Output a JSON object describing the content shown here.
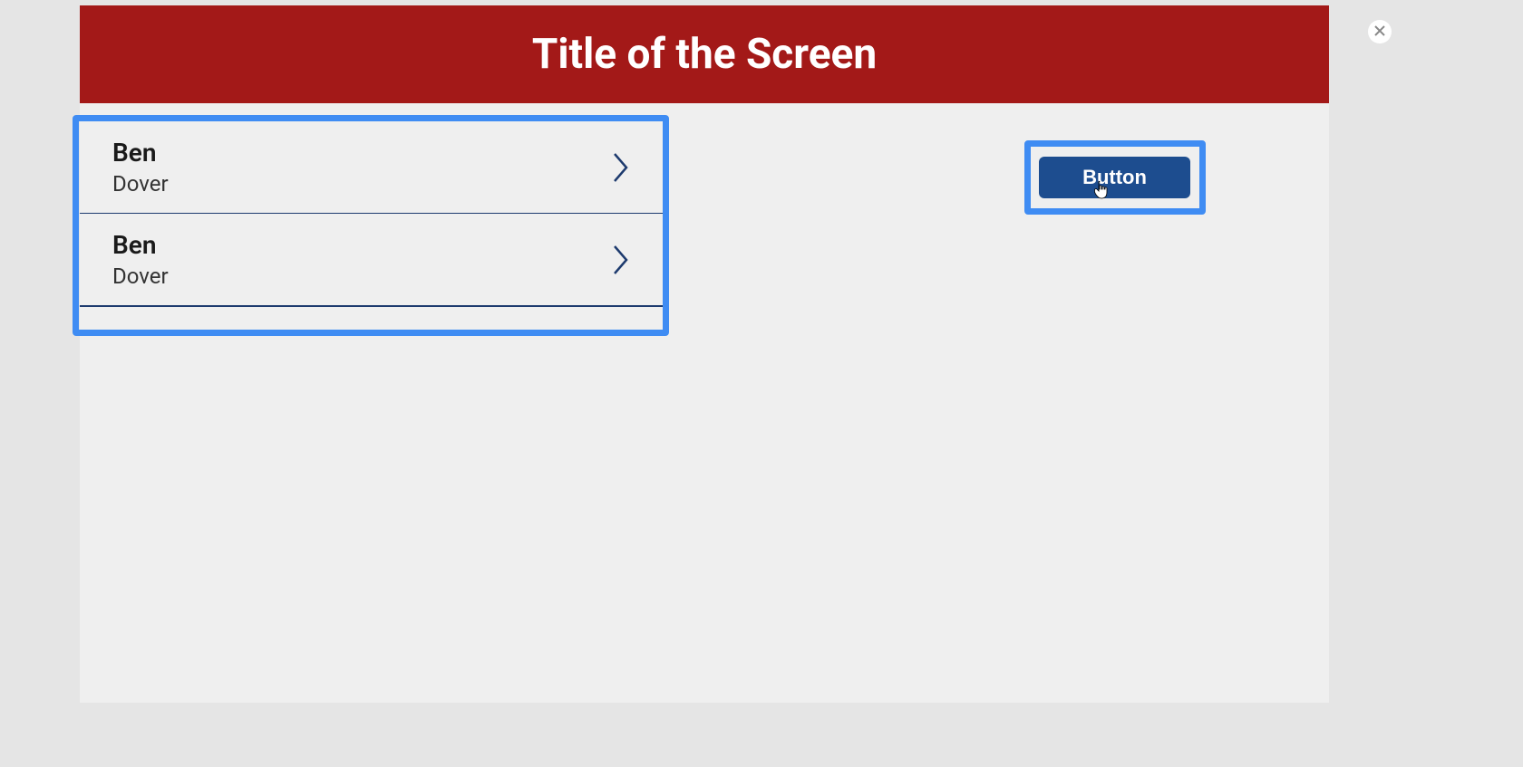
{
  "header": {
    "title": "Title of the Screen"
  },
  "list": {
    "items": [
      {
        "primary": "Ben",
        "secondary": "Dover"
      },
      {
        "primary": "Ben",
        "secondary": "Dover"
      }
    ]
  },
  "button": {
    "label": "Button"
  },
  "colors": {
    "headerBg": "#a31918",
    "highlight": "#3f8cf3",
    "buttonBg": "#1d4d8f",
    "divider": "#1d3a6e"
  }
}
